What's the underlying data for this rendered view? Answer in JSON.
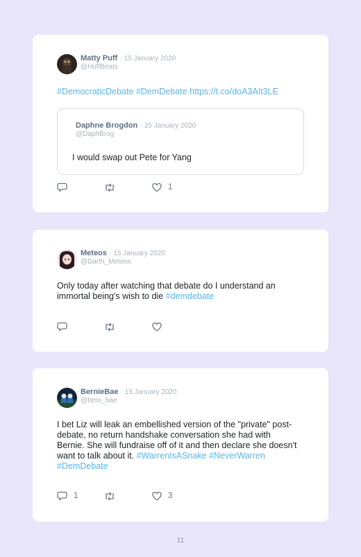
{
  "tweets": [
    {
      "author": "Matty Puff",
      "separator": "·",
      "date": "15 January 2020",
      "handle": "@HuffBeats",
      "text": "",
      "links": "#DemocraticDebate #DemDebate https://t.co/doA3AIt3LE",
      "quote": {
        "author": "Daphne Brogdon",
        "separator": "·",
        "date": "15 January 2020",
        "handle": "@DaphBrog",
        "text": "I would swap out Pete for Yang"
      },
      "reply_count": "",
      "like_count": "1"
    },
    {
      "author": "Meteos",
      "separator": "·",
      "date": "15 January 2020",
      "handle": "@Darth_Meteos",
      "text": "Only today after watching that debate do I understand an immortal being's wish to die ",
      "links": "#demdebate",
      "reply_count": "",
      "like_count": ""
    },
    {
      "author": "BernieBae",
      "separator": "·",
      "date": "15 January 2020",
      "handle": "@bern_bae",
      "text": "I bet Liz will leak an embellished version of the \"private\" post-debate, no return handshake conversation she had with Bernie. She will fundraise off of it and then declare she doesn't want to talk about it. ",
      "links": "#WarrenIsASnake #NeverWarren #DemDebate",
      "reply_count": "1",
      "like_count": "3"
    }
  ],
  "page_number": "11",
  "colors": {
    "background": "#e9e6fb",
    "card": "#ffffff",
    "link": "#59b5e3",
    "author": "#5f6f7e",
    "muted": "#a9b3bd"
  }
}
